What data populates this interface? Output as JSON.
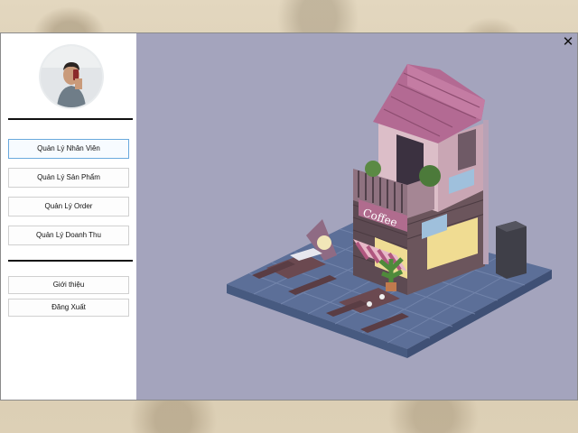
{
  "window": {
    "close_glyph": "✕"
  },
  "sidebar": {
    "menu_items": [
      {
        "label": "Quản Lý Nhân Viên"
      },
      {
        "label": "Quản Lý Sản Phẩm"
      },
      {
        "label": "Quản Lý Order"
      },
      {
        "label": "Quản Lý Doanh Thu"
      }
    ],
    "footer_items": [
      {
        "label": "Giới thiệu"
      },
      {
        "label": "Đăng Xuất"
      }
    ]
  },
  "scene": {
    "sign_text": "Coffee"
  },
  "colors": {
    "scene_background": "#a4a4bd",
    "roof": "#b36a93",
    "accent_border": "#6aa9dd"
  }
}
